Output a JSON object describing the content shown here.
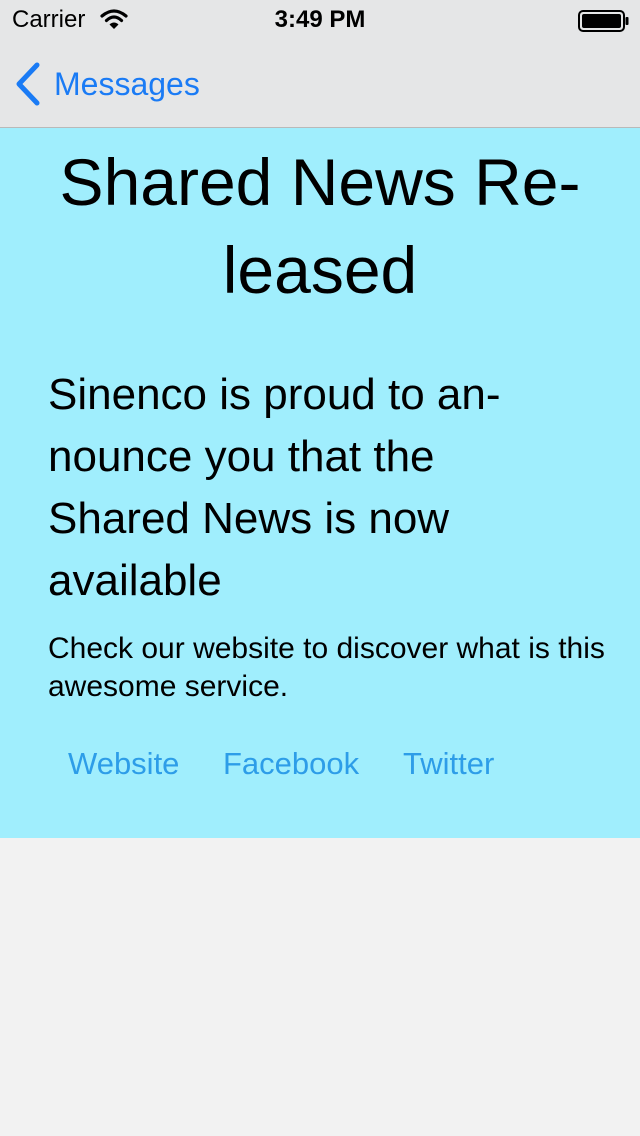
{
  "status_bar": {
    "carrier": "Carrier",
    "time": "3:49 PM"
  },
  "nav": {
    "back_label": "Messages"
  },
  "message": {
    "title": "Shared News Re-leased",
    "lead": "Sinenco is proud to an-nounce you that the Shared News is now available",
    "body": "Check our website to discover what is this awesome service."
  },
  "links": [
    {
      "label": "Website"
    },
    {
      "label": "Facebook"
    },
    {
      "label": "Twitter"
    }
  ],
  "colors": {
    "accent": "#1a7bf5",
    "card_background": "#a0eefd",
    "link": "#2d9de8",
    "page_background": "#f2f2f2"
  }
}
